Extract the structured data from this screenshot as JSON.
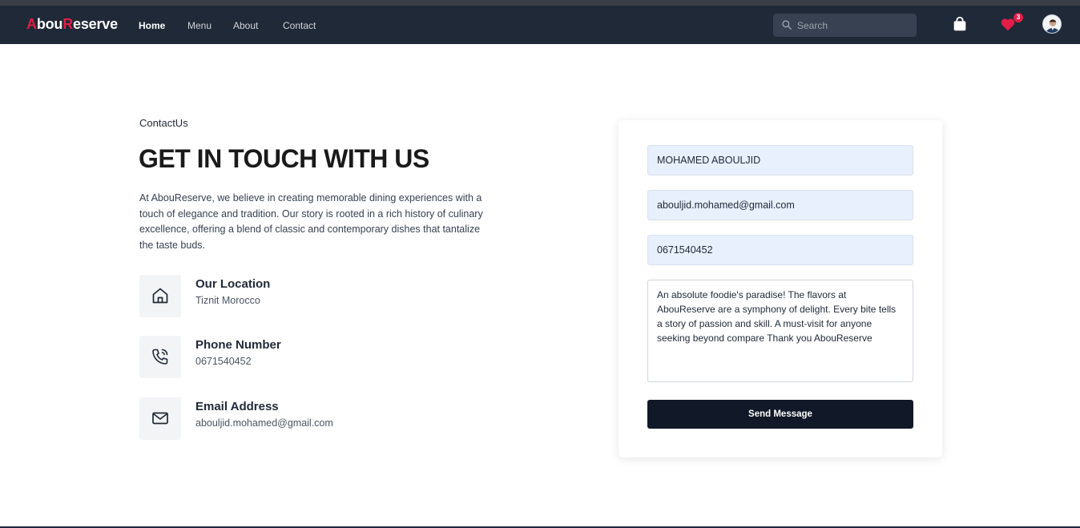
{
  "brand": {
    "a": "A",
    "b": "bou",
    "c": "R",
    "d": "eserve"
  },
  "nav": {
    "home": "Home",
    "menu": "Menu",
    "about": "About",
    "contact": "Contact"
  },
  "search": {
    "placeholder": "Search"
  },
  "favorites": {
    "count": "3"
  },
  "contact": {
    "eyebrow": "ContactUs",
    "heading": "GET IN TOUCH WITH US",
    "intro": "At AbouReserve, we believe in creating memorable dining experiences with a touch of elegance and tradition. Our story is rooted in a rich history of culinary excellence, offering a blend of classic and contemporary dishes that tantalize the taste buds.",
    "location": {
      "title": "Our Location",
      "value": "Tiznit Morocco"
    },
    "phone": {
      "title": "Phone Number",
      "value": "0671540452"
    },
    "email": {
      "title": "Email Address",
      "value": "abouljid.mohamed@gmail.com"
    }
  },
  "form": {
    "name": "MOHAMED ABOULJID",
    "email": "abouljid.mohamed@gmail.com",
    "phone": "0671540452",
    "message": "An absolute foodie's paradise! The flavors at AbouReserve are a symphony of delight. Every bite tells a story of passion and skill. A must-visit for anyone seeking beyond compare Thank you AbouReserve",
    "submit": "Send Message"
  },
  "colors": {
    "navbar": "#1f2937",
    "accent": "#e11d48",
    "button": "#111827",
    "field": "#e8f0fe"
  },
  "icons": [
    "search-icon",
    "shopping-bag-icon",
    "heart-icon",
    "home-icon",
    "phone-icon",
    "mail-icon"
  ]
}
